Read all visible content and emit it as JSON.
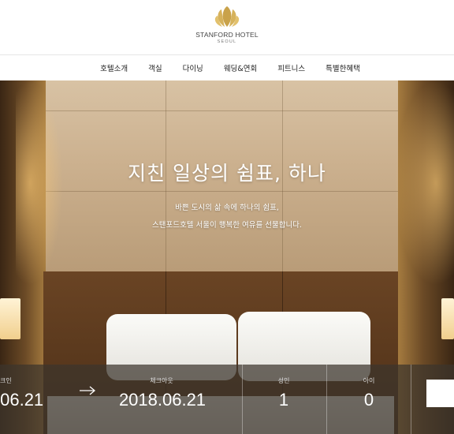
{
  "header": {
    "logo_name": "STANFORD HOTEL",
    "logo_city": "SEOUL",
    "brand_color": "#c9a24a"
  },
  "nav": {
    "items": [
      {
        "label": "호텔소개"
      },
      {
        "label": "객실"
      },
      {
        "label": "다이닝"
      },
      {
        "label": "웨딩&연회"
      },
      {
        "label": "피트니스"
      },
      {
        "label": "특별한혜택"
      }
    ]
  },
  "hero": {
    "title": "지친 일상의 쉼표, 하나",
    "subtitle_line1": "바쁜 도시의 삶 속에 하나의 쉼표,",
    "subtitle_line2": "스탠포드호텔 서울이 행복한 여유를 선물합니다."
  },
  "booking": {
    "checkin_label": "크인",
    "checkin_value": ".06.21",
    "checkout_label": "체크아웃",
    "checkout_value": "2018.06.21",
    "adults_label": "성인",
    "adults_value": "1",
    "children_label": "아이",
    "children_value": "0",
    "arrow_icon": "arrow-right-icon"
  }
}
